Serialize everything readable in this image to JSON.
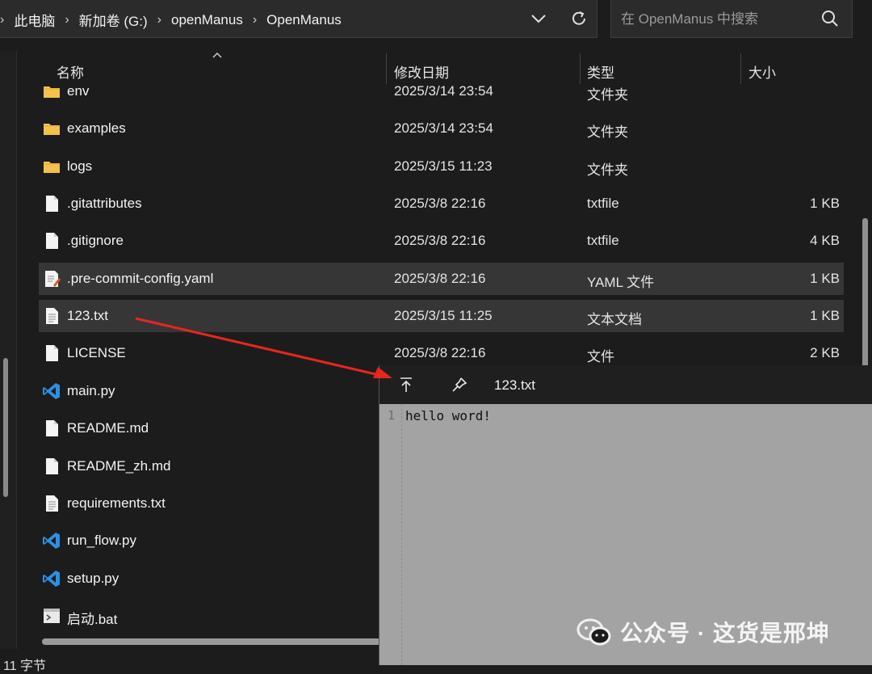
{
  "breadcrumb": [
    "此电脑",
    "新加卷 (G:)",
    "openManus",
    "OpenManus"
  ],
  "search": {
    "placeholder": "在 OpenManus 中搜索"
  },
  "columns": {
    "name": "名称",
    "date": "修改日期",
    "type": "类型",
    "size": "大小"
  },
  "files": [
    {
      "name": "env",
      "date": "2025/3/14 23:54",
      "type": "文件夹",
      "size": "",
      "icon": "folder-icon"
    },
    {
      "name": "examples",
      "date": "2025/3/14 23:54",
      "type": "文件夹",
      "size": "",
      "icon": "folder-icon"
    },
    {
      "name": "logs",
      "date": "2025/3/15 11:23",
      "type": "文件夹",
      "size": "",
      "icon": "folder-icon"
    },
    {
      "name": ".gitattributes",
      "date": "2025/3/8 22:16",
      "type": "txtfile",
      "size": "1 KB",
      "icon": "file-icon"
    },
    {
      "name": ".gitignore",
      "date": "2025/3/8 22:16",
      "type": "txtfile",
      "size": "4 KB",
      "icon": "file-icon"
    },
    {
      "name": ".pre-commit-config.yaml",
      "date": "2025/3/8 22:16",
      "type": "YAML 文件",
      "size": "1 KB",
      "icon": "yaml-file-icon"
    },
    {
      "name": "123.txt",
      "date": "2025/3/15 11:25",
      "type": "文本文档",
      "size": "1 KB",
      "icon": "text-file-icon"
    },
    {
      "name": "LICENSE",
      "date": "2025/3/8 22:16",
      "type": "文件",
      "size": "2 KB",
      "icon": "file-icon"
    },
    {
      "name": "main.py",
      "date": "",
      "type": "",
      "size": "",
      "icon": "vscode-icon"
    },
    {
      "name": "README.md",
      "date": "",
      "type": "",
      "size": "",
      "icon": "file-icon"
    },
    {
      "name": "README_zh.md",
      "date": "",
      "type": "",
      "size": "",
      "icon": "file-icon"
    },
    {
      "name": "requirements.txt",
      "date": "",
      "type": "",
      "size": "",
      "icon": "text-file-icon"
    },
    {
      "name": "run_flow.py",
      "date": "",
      "type": "",
      "size": "",
      "icon": "vscode-icon"
    },
    {
      "name": "setup.py",
      "date": "",
      "type": "",
      "size": "",
      "icon": "vscode-icon"
    },
    {
      "name": "启动.bat",
      "date": "",
      "type": "",
      "size": "",
      "icon": "bat-file-icon"
    }
  ],
  "preview": {
    "title": "123.txt",
    "line_number": "1",
    "content": "hello word!"
  },
  "status": {
    "text": "11 字节"
  },
  "watermark": {
    "text": "公众号 · 这货是邢坤"
  },
  "colors": {
    "accent_arrow": "#e8251f",
    "folder": "#f2c14e",
    "vscode": "#2f8fe3"
  }
}
